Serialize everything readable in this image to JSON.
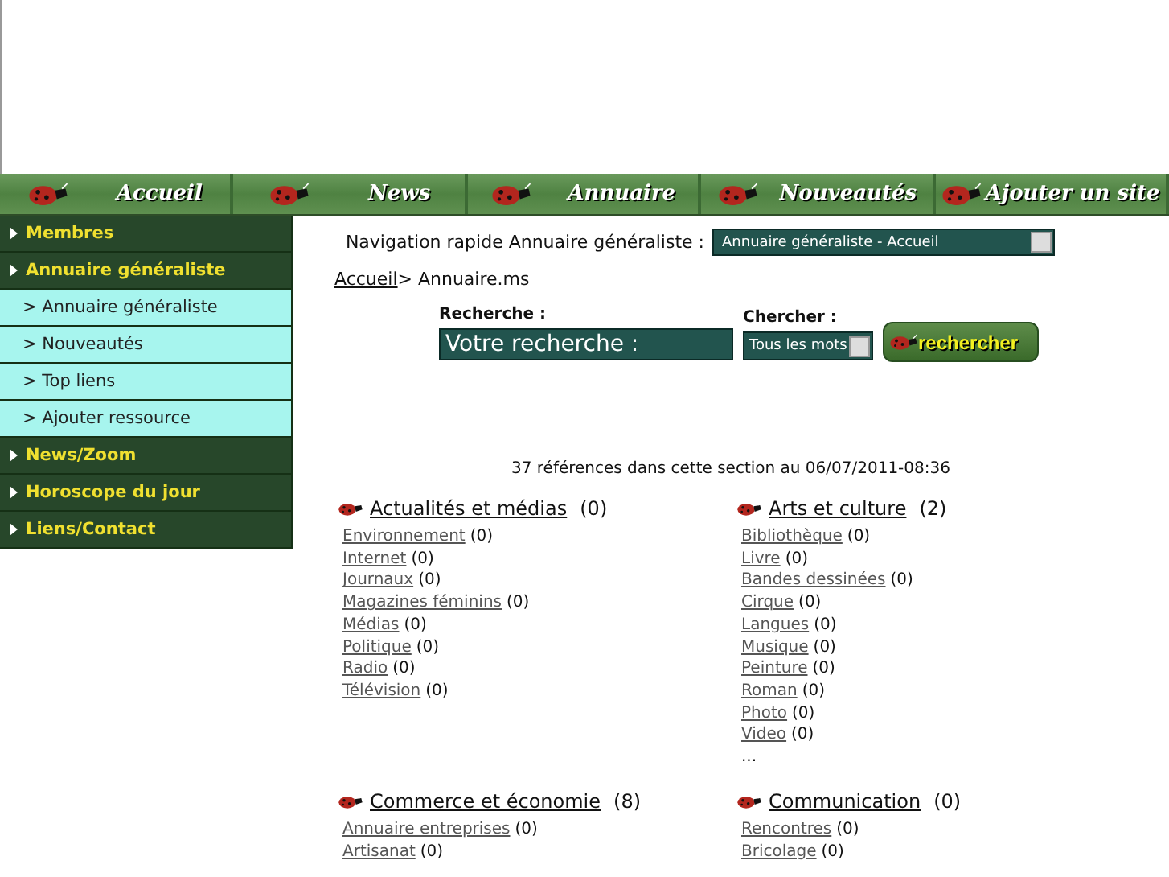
{
  "top_nav": [
    {
      "label": "Accueil"
    },
    {
      "label": "News"
    },
    {
      "label": "Annuaire"
    },
    {
      "label": "Nouveautés"
    },
    {
      "label": "Ajouter un site"
    }
  ],
  "sidebar": {
    "items": [
      {
        "kind": "section",
        "label": "Membres"
      },
      {
        "kind": "section",
        "label": "Annuaire généraliste"
      },
      {
        "kind": "sub",
        "label": "> Annuaire généraliste"
      },
      {
        "kind": "sub",
        "label": "> Nouveautés"
      },
      {
        "kind": "sub",
        "label": "> Top liens"
      },
      {
        "kind": "sub",
        "label": "> Ajouter ressource"
      },
      {
        "kind": "section",
        "label": "News/Zoom"
      },
      {
        "kind": "section",
        "label": "Horoscope du jour"
      },
      {
        "kind": "section",
        "label": "Liens/Contact"
      }
    ]
  },
  "quick_nav": {
    "label": "Navigation rapide Annuaire généraliste :",
    "value": "Annuaire généraliste - Accueil"
  },
  "breadcrumb": {
    "link": "Accueil",
    "current": "> Annuaire.ms"
  },
  "search": {
    "label": "Recherche :",
    "value": "Votre recherche :",
    "mode_label": "Chercher :",
    "mode_value": "Tous les mots",
    "button": "rechercher"
  },
  "summary": "37 références dans cette section au 06/07/2011-08:36",
  "categories": [
    {
      "title": "Actualités et médias",
      "count": "(0)",
      "items": [
        {
          "name": "Environnement",
          "count": "(0)"
        },
        {
          "name": "Internet",
          "count": "(0)"
        },
        {
          "name": "Journaux",
          "count": "(0)"
        },
        {
          "name": "Magazines féminins",
          "count": "(0)"
        },
        {
          "name": "Médias",
          "count": "(0)"
        },
        {
          "name": "Politique",
          "count": "(0)"
        },
        {
          "name": "Radio",
          "count": "(0)"
        },
        {
          "name": "Télévision",
          "count": "(0)"
        }
      ]
    },
    {
      "title": "Arts et culture",
      "count": "(2)",
      "items": [
        {
          "name": "Bibliothèque",
          "count": "(0)"
        },
        {
          "name": "Livre",
          "count": "(0)"
        },
        {
          "name": "Bandes dessinées",
          "count": "(0)"
        },
        {
          "name": "Cirque",
          "count": "(0)"
        },
        {
          "name": "Langues",
          "count": "(0)"
        },
        {
          "name": "Musique",
          "count": "(0)"
        },
        {
          "name": "Peinture",
          "count": "(0)"
        },
        {
          "name": "Roman",
          "count": "(0)"
        },
        {
          "name": "Photo",
          "count": "(0)"
        },
        {
          "name": "Video",
          "count": "(0)"
        }
      ],
      "more": "..."
    },
    {
      "title": "Commerce et économie",
      "count": "(8)",
      "items": [
        {
          "name": "Annuaire entreprises",
          "count": "(0)"
        },
        {
          "name": "Artisanat",
          "count": "(0)"
        }
      ]
    },
    {
      "title": "Communication",
      "count": "(0)",
      "items": [
        {
          "name": "Rencontres",
          "count": "(0)"
        },
        {
          "name": "Bricolage",
          "count": "(0)"
        }
      ]
    }
  ]
}
